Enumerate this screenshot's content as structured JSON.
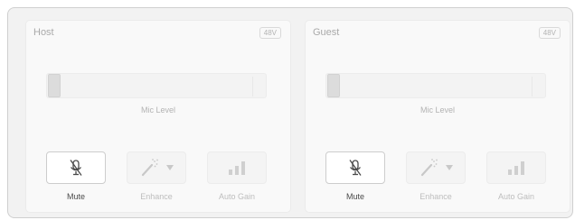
{
  "channels": [
    {
      "name": "Host",
      "phantom_badge": "48V",
      "mic_level_label": "Mic Level",
      "mic_level_value": 0,
      "mute_label": "Mute",
      "enhance_label": "Enhance",
      "auto_gain_label": "Auto Gain"
    },
    {
      "name": "Guest",
      "phantom_badge": "48V",
      "mic_level_label": "Mic Level",
      "mic_level_value": 0,
      "mute_label": "Mute",
      "enhance_label": "Enhance",
      "auto_gain_label": "Auto Gain"
    }
  ],
  "icons": {
    "mute": "mic-off-icon",
    "enhance": "magic-wand-icon",
    "enhance_menu": "dropdown-triangle-icon",
    "auto_gain": "signal-bars-icon"
  },
  "colors": {
    "background": "#f2f2f2",
    "panel": "#f9f9f9",
    "active_text": "#4a4a4a",
    "disabled_text": "#bdbdbd"
  }
}
